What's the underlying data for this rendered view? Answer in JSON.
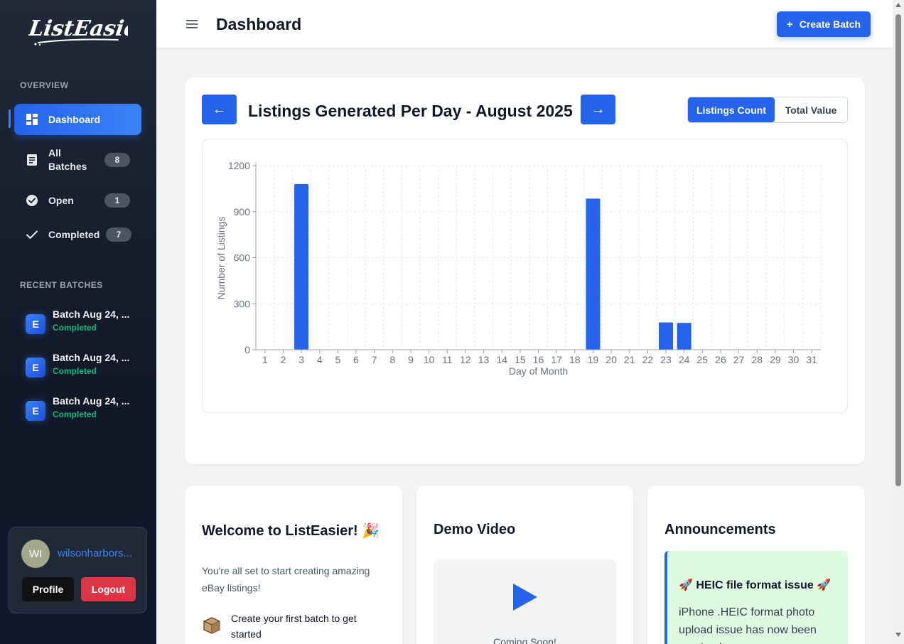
{
  "app": {
    "logo_text": "ListEasier"
  },
  "sidebar": {
    "overview_title": "OVERVIEW",
    "items": [
      {
        "label": "Dashboard",
        "badge": ""
      },
      {
        "label": "All Batches",
        "badge": "8"
      },
      {
        "label": "Open",
        "badge": "1"
      },
      {
        "label": "Completed",
        "badge": "7"
      }
    ],
    "recent_title": "RECENT BATCHES",
    "recent_batches": [
      {
        "avatar": "E",
        "name": "Batch Aug 24, ...",
        "status": "Completed"
      },
      {
        "avatar": "E",
        "name": "Batch Aug 24, ...",
        "status": "Completed"
      },
      {
        "avatar": "E",
        "name": "Batch Aug 24, ...",
        "status": "Completed"
      }
    ],
    "user": {
      "initials": "WI",
      "username": "wilsonharbors...",
      "profile_label": "Profile",
      "logout_label": "Logout"
    }
  },
  "header": {
    "title": "Dashboard",
    "create_label": "Create Batch",
    "create_icon": "+"
  },
  "chart_card": {
    "prev_label": "←",
    "next_label": "→",
    "title": "Listings Generated Per Day - August 2025",
    "toggle": {
      "active": "Listings Count",
      "inactive": "Total Value"
    }
  },
  "chart_data": {
    "type": "bar",
    "title": "Listings Generated Per Day - August 2025",
    "xlabel": "Day of Month",
    "ylabel": "Number of Listings",
    "categories": [
      "1",
      "2",
      "3",
      "4",
      "5",
      "6",
      "7",
      "8",
      "9",
      "10",
      "11",
      "12",
      "13",
      "14",
      "15",
      "16",
      "17",
      "18",
      "19",
      "20",
      "21",
      "22",
      "23",
      "24",
      "25",
      "26",
      "27",
      "28",
      "29",
      "30",
      "31"
    ],
    "values": [
      0,
      0,
      1080,
      0,
      0,
      0,
      0,
      0,
      0,
      0,
      0,
      0,
      0,
      0,
      0,
      0,
      0,
      0,
      985,
      0,
      0,
      0,
      178,
      175,
      0,
      0,
      0,
      0,
      0,
      0,
      0
    ],
    "ylim": [
      0,
      1200
    ],
    "yticks": [
      0,
      300,
      600,
      900,
      1200
    ],
    "grid": true,
    "bar_color": "#2563eb"
  },
  "cards": {
    "welcome": {
      "title": "Welcome to ListEasier! 🎉",
      "text": "You're all set to start creating amazing eBay listings!",
      "step": "Create your first batch to get started"
    },
    "demo": {
      "title": "Demo Video",
      "coming_soon": "Coming Soon!"
    },
    "announcements": {
      "title": "Announcements",
      "item_title": "🚀 HEIC file format issue 🚀",
      "item_text": "iPhone .HEIC format photo upload issue has now been resolved"
    }
  },
  "colors": {
    "accent": "#2563eb",
    "success": "#10b981",
    "danger": "#dc3545",
    "sidebar_bg": "#1f2937"
  }
}
